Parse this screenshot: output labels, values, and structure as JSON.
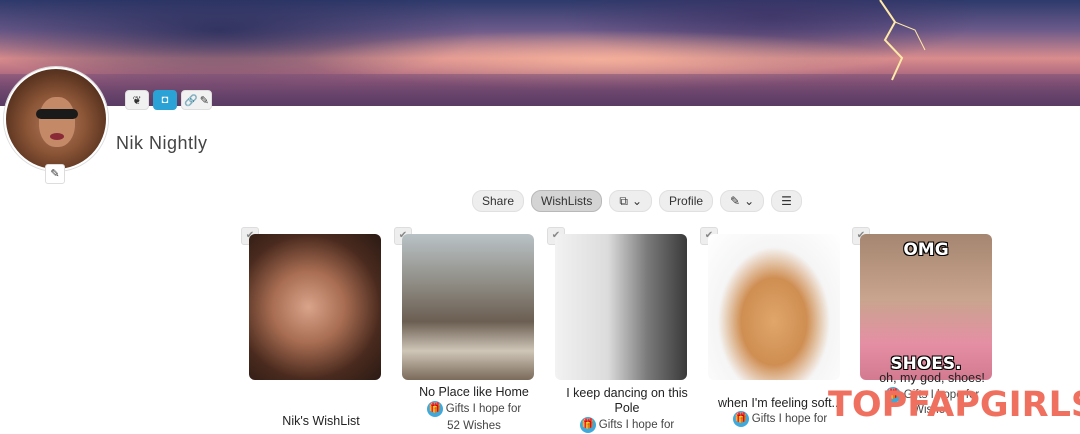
{
  "profile": {
    "name": "Nik Nightly",
    "edit_icon": "pencil-icon"
  },
  "badges": [
    {
      "icon": "celtic-knot-icon"
    },
    {
      "icon": "square-badge-icon"
    },
    {
      "icon": "link-icon"
    }
  ],
  "actions": {
    "share": "Share",
    "wishlists": "WishLists",
    "profile": "Profile"
  },
  "cards": [
    {
      "title": "Nik's WishList",
      "sub1": "",
      "sub2": ""
    },
    {
      "title": "No Place like Home",
      "sub1": "Gifts I hope for",
      "sub2": "52 Wishes"
    },
    {
      "title": "I keep dancing on this Pole",
      "sub1": "Gifts I hope for",
      "sub2": ""
    },
    {
      "title": "when I'm feeling soft...",
      "sub1": "Gifts I hope for",
      "sub2": ""
    },
    {
      "title": "oh, my god, shoes!",
      "sub1": "Gifts I hope for",
      "sub2": "Wishes",
      "meme_top": "OMG",
      "meme_bottom": "SHOES."
    }
  ],
  "watermark": "TOPFAPGIRLS",
  "colors": {
    "accent": "#3fa9dc",
    "watermark": "#f07060"
  }
}
